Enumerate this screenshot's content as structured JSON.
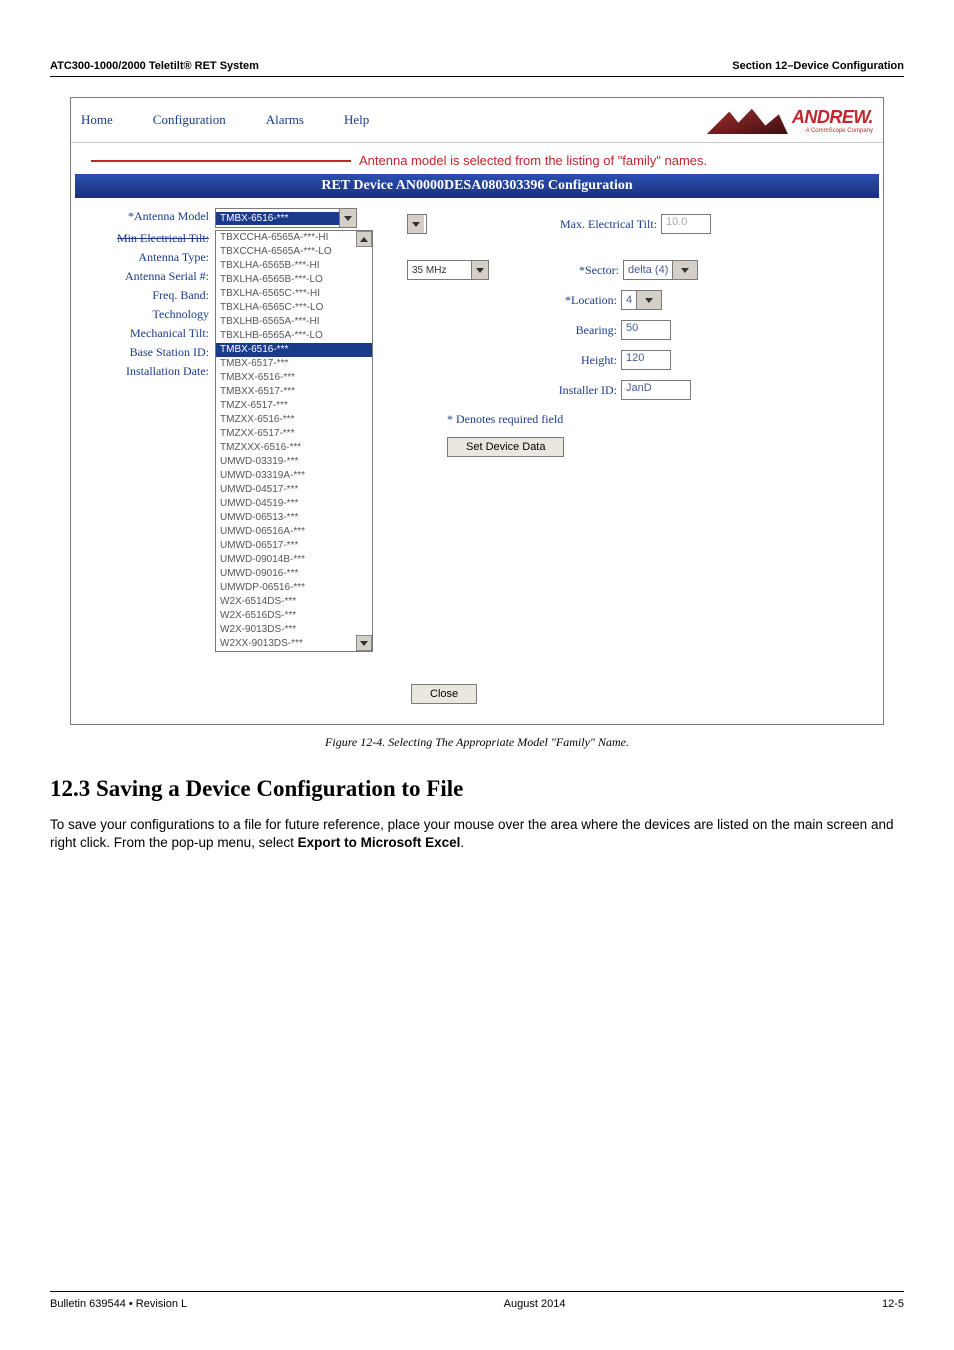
{
  "header": {
    "left": "ATC300-1000/2000 Teletilt® RET System",
    "right": "Section 12–Device Configuration"
  },
  "menu": {
    "home": "Home",
    "config": "Configuration",
    "alarms": "Alarms",
    "help": "Help"
  },
  "logo": {
    "text": "ANDREW.",
    "sub": "A CommScope Company"
  },
  "annotation": "Antenna model is selected from the listing of \"family\" names.",
  "config_title": "RET Device AN0000DESA080303396 Configuration",
  "labels": {
    "antenna_model": "*Antenna Model",
    "min_tilt": "Min Electrical Tilt:",
    "antenna_type": "Antenna Type:",
    "antenna_serial": "Antenna Serial #:",
    "freq_band": "Freq. Band:",
    "technology": "Technology",
    "mech_tilt": "Mechanical Tilt:",
    "base_station": "Base Station ID:",
    "install_date": "Installation Date:",
    "max_tilt": "Max. Electrical Tilt:",
    "sector": "*Sector:",
    "location": "*Location:",
    "bearing": "Bearing:",
    "height": "Height:",
    "installer": "Installer ID:"
  },
  "values": {
    "antenna_model_selected": "TMBX-6516-***",
    "freq_dropdown": "35 MHz",
    "max_tilt": "10.0",
    "sector": "delta (4)",
    "location": "4",
    "bearing": "50",
    "height": "120",
    "installer": "JanD"
  },
  "dropdown_options": [
    "TBXCCHA-6565A-***-HI",
    "TBXCCHA-6565A-***-LO",
    "TBXLHA-6565B-***-HI",
    "TBXLHA-6565B-***-LO",
    "TBXLHA-6565C-***-HI",
    "TBXLHA-6565C-***-LO",
    "TBXLHB-6565A-***-HI",
    "TBXLHB-6565A-***-LO",
    "TMBX-6516-***",
    "TMBX-6517-***",
    "TMBXX-6516-***",
    "TMBXX-6517-***",
    "TMZX-6517-***",
    "TMZXX-6516-***",
    "TMZXX-6517-***",
    "TMZXXX-6516-***",
    "UMWD-03319-***",
    "UMWD-03319A-***",
    "UMWD-04517-***",
    "UMWD-04519-***",
    "UMWD-06513-***",
    "UMWD-06516A-***",
    "UMWD-06517-***",
    "UMWD-09014B-***",
    "UMWD-09016-***",
    "UMWDP-06516-***",
    "W2X-6514DS-***",
    "W2X-6516DS-***",
    "W2X-9013DS-***",
    "W2XX-9013DS-***"
  ],
  "selected_index": 8,
  "denotes": "* Denotes required field",
  "buttons": {
    "set": "Set Device Data",
    "close": "Close"
  },
  "figure_caption": "Figure 12-4.  Selecting The Appropriate Model \"Family\" Name.",
  "section_heading": "12.3 Saving a Device Configuration to File",
  "body_text": "To save your configurations to a file for future reference, place your mouse over the area where the devices are listed on the main screen and right click. From the pop-up menu, select ",
  "body_bold": "Export to Microsoft Excel",
  "body_tail": ".",
  "footer": {
    "left": "Bulletin 639544  •  Revision L",
    "center": "August 2014",
    "right": "12-5"
  }
}
